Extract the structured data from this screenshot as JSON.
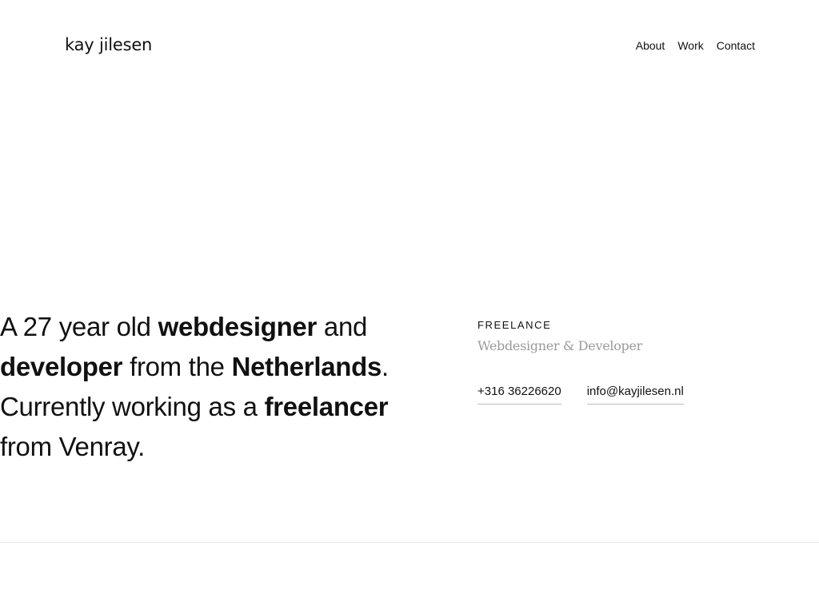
{
  "header": {
    "logo": "kay jilesen",
    "nav": [
      {
        "label": "About"
      },
      {
        "label": "Work"
      },
      {
        "label": "Contact"
      }
    ]
  },
  "intro": {
    "parts": [
      "A 27 year old ",
      "webdesigner",
      " and ",
      "developer",
      " from the ",
      "Netherlands",
      ". Currently working as a ",
      "freelancer",
      " from Venray."
    ]
  },
  "side": {
    "kicker": "FREELANCE",
    "role": "Webdesigner & Developer",
    "phone": "+316 36226620",
    "email": "info@kayjilesen.nl"
  },
  "colors": {
    "text": "#111111",
    "muted": "#9a9a9a",
    "divider": "#e6e6e6",
    "underline": "#bdbdbd"
  }
}
